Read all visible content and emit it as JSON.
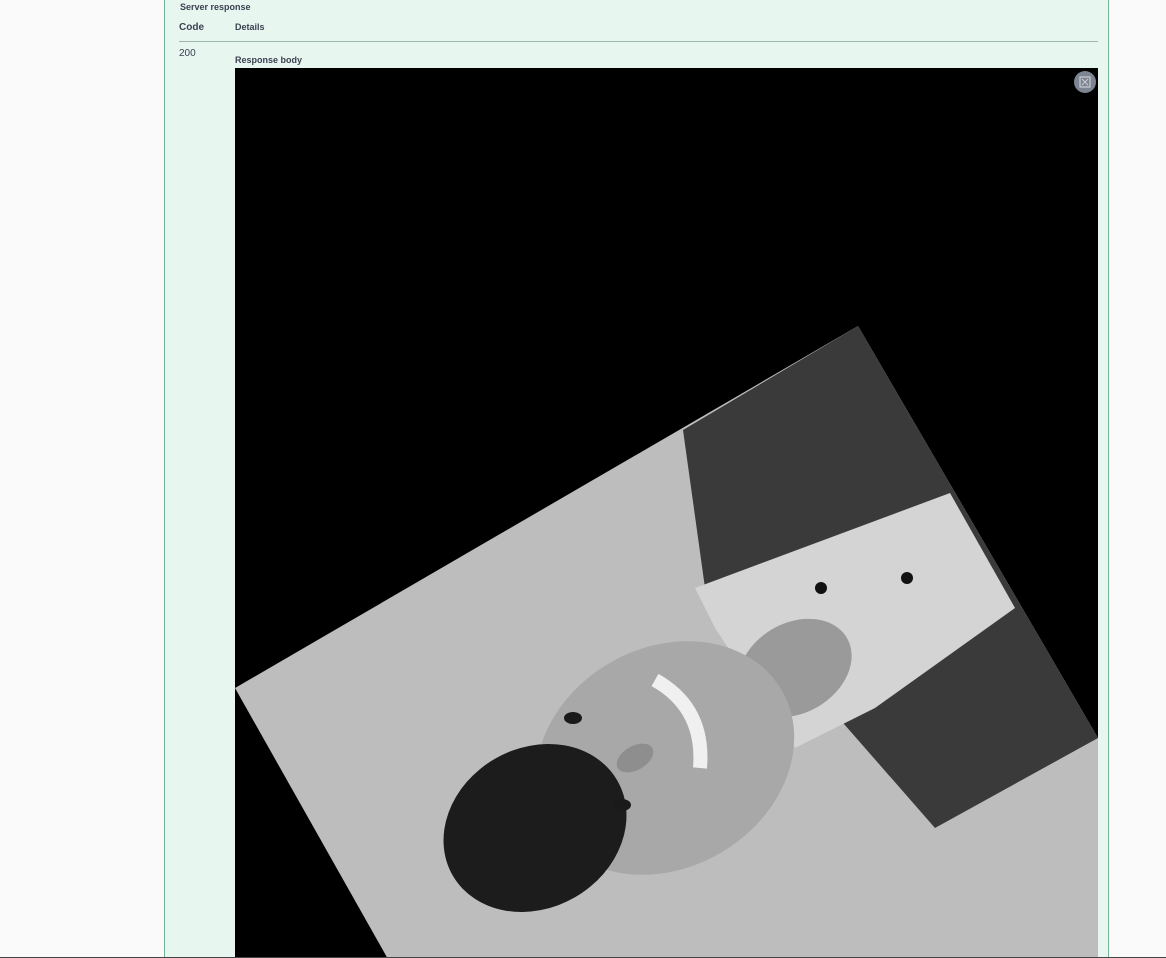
{
  "response": {
    "section_title": "Server response",
    "col_code": "Code",
    "col_details": "Details",
    "status_code": "200",
    "body_label": "Response body"
  },
  "image": {
    "description_icon": "expand-icon"
  },
  "colors": {
    "panel_background": "#e8f6f0",
    "panel_border": "#49cc90",
    "image_background": "#000000",
    "expand_button": "#7d8492"
  }
}
